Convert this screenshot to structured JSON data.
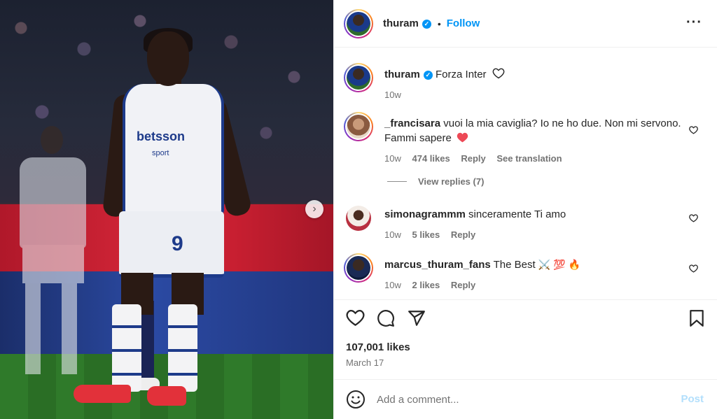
{
  "post": {
    "owner": "thuram",
    "follow_label": "Follow",
    "dot": "•",
    "more_label": "···",
    "caption": "Forza Inter",
    "caption_age": "10w",
    "likes": "107,001 likes",
    "date": "March 17"
  },
  "comments": [
    {
      "user": "_francisara",
      "text": "vuoi la mia caviglia? Io ne ho due. Non mi servono. Fammi sapere",
      "age": "10w",
      "likes": "474 likes",
      "reply": "Reply",
      "translation": "See translation",
      "view_replies": "View replies (7)"
    },
    {
      "user": "simonagrammm",
      "text": "sinceramente Ti amo",
      "age": "10w",
      "likes": "5 likes",
      "reply": "Reply"
    },
    {
      "user": "marcus_thuram_fans",
      "text": "The Best",
      "emojis": "⚔️ 💯 🔥",
      "age": "10w",
      "likes": "2 likes",
      "reply": "Reply"
    }
  ],
  "composer": {
    "placeholder": "Add a comment...",
    "post_label": "Post"
  },
  "photo": {
    "sponsor": "betsson",
    "sponsor_sub": "sport",
    "jersey_number": "9"
  },
  "colors": {
    "accent": "#0095f6",
    "heart": "#ed4956",
    "muted": "#737373"
  },
  "icons": {
    "like": "heart-icon",
    "comment": "comment-icon",
    "share": "share-icon",
    "save": "bookmark-icon",
    "emoji": "emoji-icon",
    "verified": "verified-icon",
    "next": "chevron-right-icon"
  }
}
